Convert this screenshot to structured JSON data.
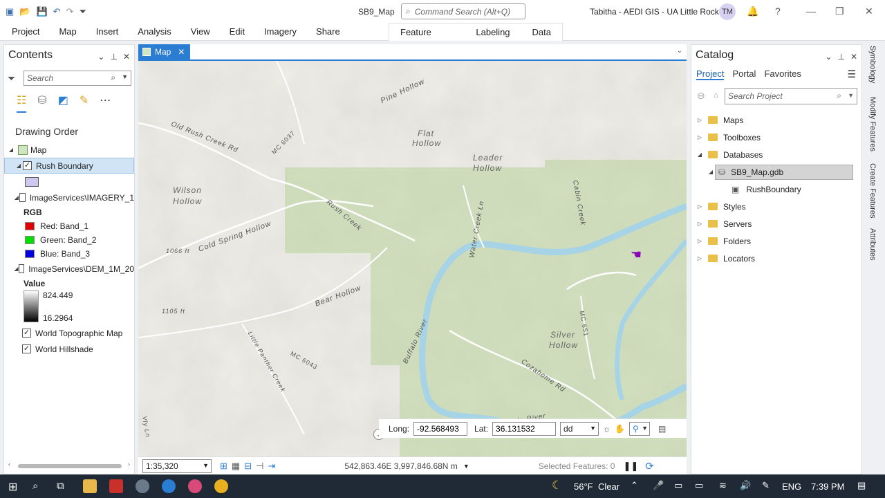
{
  "titlebar": {
    "doc_title": "SB9_Map",
    "command_search_placeholder": "Command Search (Alt+Q)",
    "user": "Tabitha - AEDI GIS - UA Little Rock",
    "avatar": "TM",
    "help": "?"
  },
  "ribbon": {
    "tabs": [
      "Project",
      "Map",
      "Insert",
      "Analysis",
      "View",
      "Edit",
      "Imagery",
      "Share"
    ],
    "context_tabs": [
      "Feature Layer",
      "Labeling",
      "Data"
    ]
  },
  "contents": {
    "title": "Contents",
    "search_placeholder": "Search",
    "section_title": "Drawing Order",
    "map_item": "Map",
    "layers": {
      "rush_boundary": "Rush Boundary",
      "imagery": "ImageServices\\IMAGERY_1",
      "rgb_label": "RGB",
      "red": "Red:  Band_1",
      "green": "Green:  Band_2",
      "blue": "Blue:  Band_3",
      "dem": "ImageServices\\DEM_1M_20",
      "value_label": "Value",
      "value_max": "824.449",
      "value_min": "16.2964",
      "topo": "World Topographic Map",
      "hillshade": "World Hillshade"
    },
    "colors": {
      "red": "#e00000",
      "green": "#00e000",
      "blue": "#0000e0",
      "rush_fill": "#ccc8f0"
    }
  },
  "map": {
    "tab_label": "Map",
    "labels": {
      "pine_hollow": "Pine Hollow",
      "flat_hollow_1": "Flat",
      "flat_hollow_2": "Hollow",
      "leader_hollow_1": "Leader",
      "leader_hollow_2": "Hollow",
      "old_rush_creek": "Old Rush Creek Rd",
      "mc6037": "MC 6037",
      "wilson_1": "Wilson",
      "wilson_2": "Hollow",
      "rush_creek": "Rush Creek",
      "water_creek": "Water Creek Ln",
      "cabin_creek": "Cabin Creek",
      "cold_spring": "Cold Spring Hollow",
      "elev1066": "1066 ft",
      "bear_hollow": "Bear Hollow",
      "elev1105": "1105 ft",
      "buffalo_river_1": "Buffalo River",
      "silver_1": "Silver",
      "silver_2": "Hollow",
      "mc651": "MC 651",
      "little_panther": "Little Panther Creek",
      "mc6043": "MC 6043",
      "cozahome": "Cozahome Rd",
      "buffalo_river_2": "Buffalo River",
      "vly_ln": "Vly Ln"
    },
    "coords": {
      "long_label": "Long:",
      "long_value": "-92.568493",
      "lat_label": "Lat:",
      "lat_value": "36.131532",
      "format": "dd"
    },
    "status": {
      "scale": "1:35,320",
      "position": "542,863.46E 3,997,846.68N m",
      "selected_features": "Selected Features: 0"
    }
  },
  "catalog": {
    "title": "Catalog",
    "tabs": [
      "Project",
      "Portal",
      "Favorites"
    ],
    "search_placeholder": "Search Project",
    "items": {
      "maps": "Maps",
      "toolboxes": "Toolboxes",
      "databases": "Databases",
      "gdb": "SB9_Map.gdb",
      "rushboundary": "RushBoundary",
      "styles": "Styles",
      "servers": "Servers",
      "folders": "Folders",
      "locators": "Locators"
    }
  },
  "side_tabs": [
    "Symbology",
    "Modify Features",
    "Create Features",
    "Attributes"
  ],
  "taskbar": {
    "weather_temp": "56°F",
    "weather_desc": "Clear",
    "language": "ENG",
    "time": "7:39 PM"
  }
}
